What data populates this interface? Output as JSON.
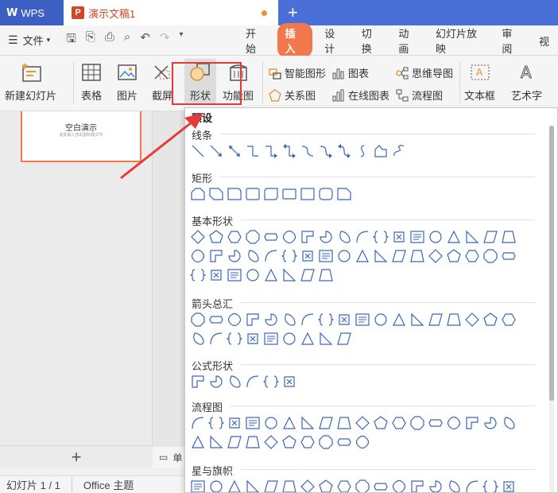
{
  "titlebar": {
    "wps_label": "WPS",
    "doc_tab_label": "演示文稿1",
    "ppt_icon": "P",
    "new_tab_symbol": "+"
  },
  "menubar": {
    "file_label": "文件",
    "items": [
      "开始",
      "插入",
      "设计",
      "切换",
      "动画",
      "幻灯片放映",
      "审阅",
      "视"
    ],
    "active_item": "插入"
  },
  "ribbon": {
    "new_slide": "新建幻灯片",
    "table": "表格",
    "picture": "图片",
    "screenshot": "截屏",
    "shape": "形状",
    "function_chart": "功能图",
    "smart_shape": "智能图形",
    "chart": "图表",
    "mindmap": "思维导图",
    "relation_chart": "关系图",
    "online_chart": "在线图表",
    "flowchart": "流程图",
    "textbox": "文本框",
    "wordart": "艺术字"
  },
  "slide_panel": {
    "thumb_title": "空白演示",
    "thumb_subtitle": "此处输入您的副标题文字",
    "add_symbol": "+"
  },
  "notes_label": "单",
  "statusbar": {
    "slide_info": "幻灯片 1 / 1",
    "theme": "Office 主题"
  },
  "dropdown": {
    "preset_label": "预设",
    "sections": [
      {
        "title": "线条",
        "rows": [
          12
        ]
      },
      {
        "title": "矩形",
        "rows": [
          9
        ]
      },
      {
        "title": "基本形状",
        "rows": [
          18,
          18,
          8
        ]
      },
      {
        "title": "箭头总汇",
        "rows": [
          18,
          9
        ]
      },
      {
        "title": "公式形状",
        "rows": [
          6
        ]
      },
      {
        "title": "流程图",
        "rows": [
          18,
          10
        ]
      },
      {
        "title": "星与旗帜",
        "rows": [
          18
        ]
      }
    ]
  },
  "colors": {
    "title_blue": "#4a6fd6",
    "accent_orange": "#f0784c",
    "highlight_red": "#e53935",
    "shape_stroke": "#3a66b8"
  }
}
